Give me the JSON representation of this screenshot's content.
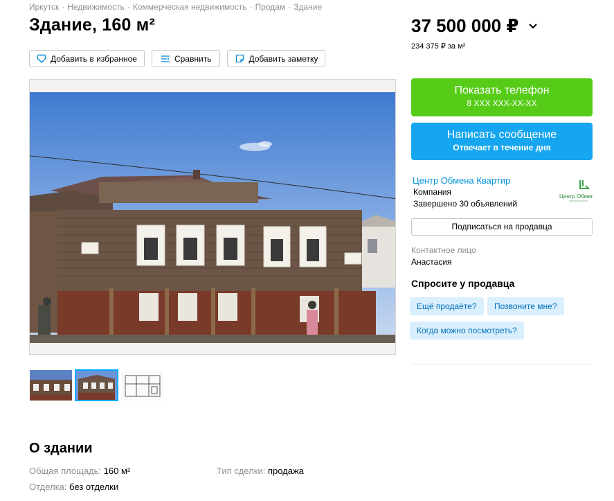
{
  "breadcrumbs": [
    "Иркутск",
    "Недвижимость",
    "Коммерческая недвижимость",
    "Продам",
    "Здание"
  ],
  "title": "Здание, 160 м²",
  "actions": {
    "favorite": "Добавить в избранное",
    "compare": "Сравнить",
    "note": "Добавить заметку"
  },
  "price": {
    "value": "37 500 000 ₽",
    "per_m2": "234 375 ₽ за м²"
  },
  "phone_button": {
    "label": "Показать телефон",
    "number": "8 XXX XXX-XX-XX"
  },
  "message_button": {
    "label": "Написать сообщение",
    "sub": "Отвечает в течение дня"
  },
  "seller": {
    "name": "Центр Обмена Квартир",
    "type": "Компания",
    "completed": "Завершено 30 объявлений",
    "logo_text": "Центр Обмена",
    "subscribe": "Подписаться на продавца"
  },
  "contact": {
    "label": "Контактное лицо",
    "name": "Анастасия"
  },
  "ask": {
    "title": "Спросите у продавца",
    "chips": [
      "Ещё продаёте?",
      "Позвоните мне?",
      "Когда можно посмотреть?"
    ]
  },
  "about": {
    "title": "О здании",
    "params": [
      {
        "key": "Общая площадь:",
        "value": "160 м²"
      },
      {
        "key": "Тип сделки:",
        "value": "продажа"
      },
      {
        "key": "Отделка:",
        "value": "без отделки"
      }
    ]
  },
  "colors": {
    "phone_green": "#56cc19",
    "message_blue": "#16a6f0",
    "link_blue": "#0091d9",
    "chip_bg": "#d9effd"
  },
  "icons": [
    "heart-icon",
    "compare-icon",
    "note-icon",
    "chevron-down-icon"
  ]
}
